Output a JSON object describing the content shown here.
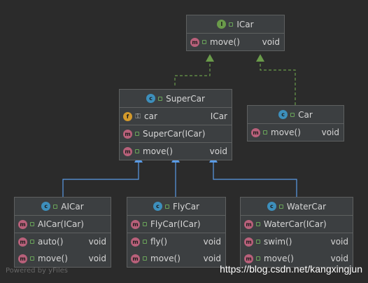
{
  "colors": {
    "background": "#2b2b2b",
    "box": "#3c3f41",
    "implements_arrow": "#6a9b4a",
    "extends_arrow": "#5a9be6"
  },
  "classes": {
    "icar": {
      "kind": "interface",
      "name": "ICar",
      "methods": [
        {
          "name": "move()",
          "type": "void"
        }
      ]
    },
    "supercar": {
      "kind": "class",
      "name": "SuperCar",
      "fields": [
        {
          "name": "car",
          "type": "ICar"
        }
      ],
      "constructors": [
        {
          "name": "SuperCar(ICar)"
        }
      ],
      "methods": [
        {
          "name": "move()",
          "type": "void"
        }
      ]
    },
    "car": {
      "kind": "class",
      "name": "Car",
      "methods": [
        {
          "name": "move()",
          "type": "void"
        }
      ]
    },
    "aicar": {
      "kind": "class",
      "name": "AICar",
      "constructors": [
        {
          "name": "AICar(ICar)"
        }
      ],
      "methods": [
        {
          "name": "auto()",
          "type": "void"
        },
        {
          "name": "move()",
          "type": "void"
        }
      ]
    },
    "flycar": {
      "kind": "class",
      "name": "FlyCar",
      "constructors": [
        {
          "name": "FlyCar(ICar)"
        }
      ],
      "methods": [
        {
          "name": "fly()",
          "type": "void"
        },
        {
          "name": "move()",
          "type": "void"
        }
      ]
    },
    "watercar": {
      "kind": "class",
      "name": "WaterCar",
      "constructors": [
        {
          "name": "WaterCar(ICar)"
        }
      ],
      "methods": [
        {
          "name": "swim()",
          "type": "void"
        },
        {
          "name": "move()",
          "type": "void"
        }
      ]
    }
  },
  "relations": [
    {
      "from": "SuperCar",
      "to": "ICar",
      "kind": "implements"
    },
    {
      "from": "Car",
      "to": "ICar",
      "kind": "implements"
    },
    {
      "from": "AICar",
      "to": "SuperCar",
      "kind": "extends"
    },
    {
      "from": "FlyCar",
      "to": "SuperCar",
      "kind": "extends"
    },
    {
      "from": "WaterCar",
      "to": "SuperCar",
      "kind": "extends"
    }
  ],
  "watermark_left": "Powered by yFiles",
  "watermark_right": "https://blog.csdn.net/kangxingjun"
}
